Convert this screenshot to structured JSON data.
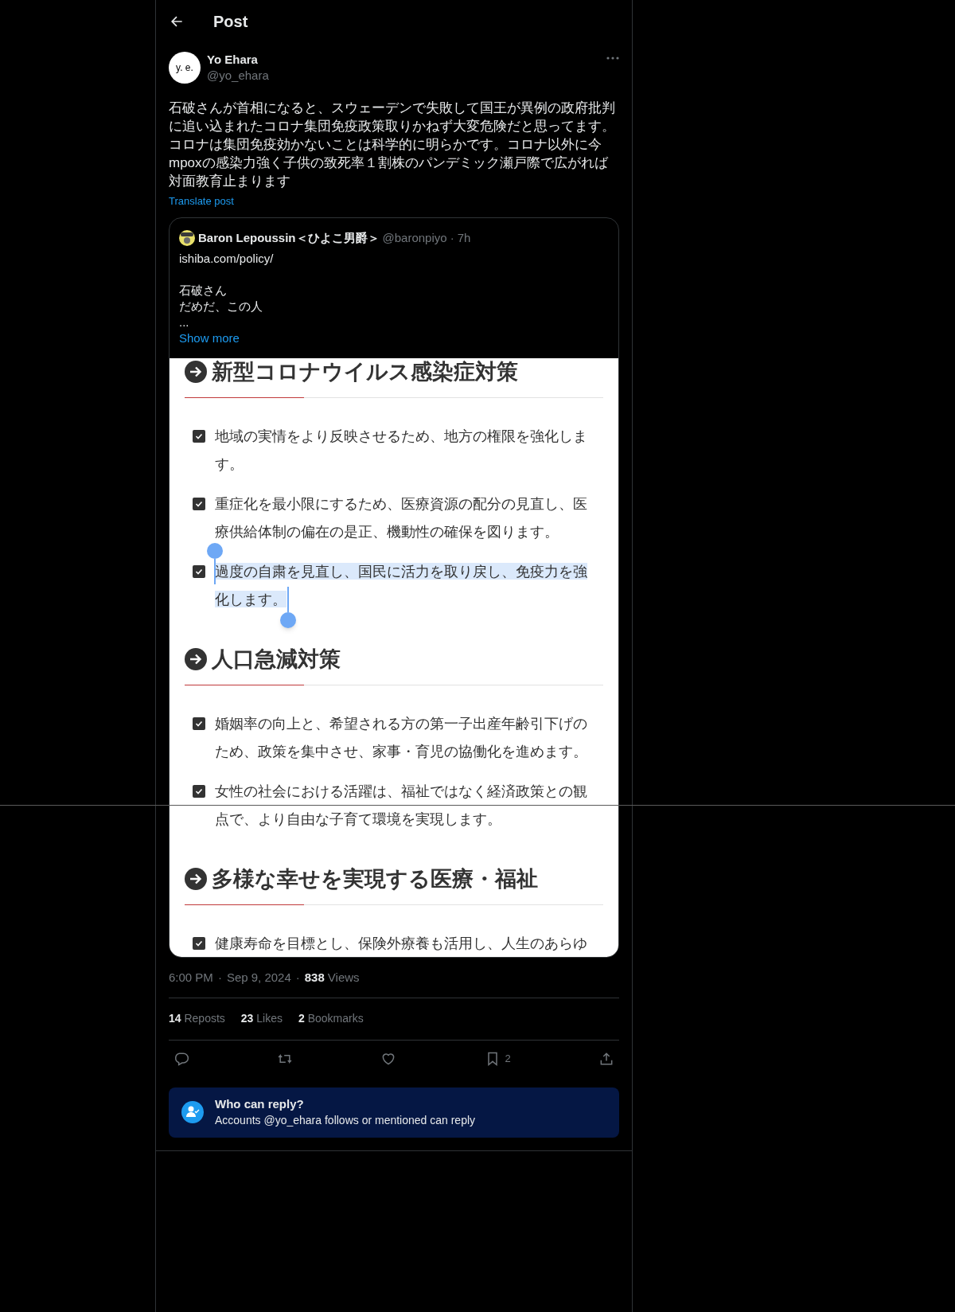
{
  "header": {
    "title": "Post"
  },
  "post": {
    "author": {
      "avatar_text": "y. e.",
      "name": "Yo Ehara",
      "handle": "@yo_ehara"
    },
    "text": "石破さんが首相になると、スウェーデンで失敗して国王が異例の政府批判に追い込まれたコロナ集団免疫政策取りかねず大変危険だと思ってます。コロナは集団免疫効かないことは科学的に明らかです。コロナ以外に今mpoxの感染力強く子供の致死率１割株のパンデミック瀬戸際で広がれば対面教育止まります",
    "translate": "Translate post"
  },
  "quote": {
    "name": "Baron Lepoussin＜ひよこ男爵＞",
    "handle": "@baronpiyo",
    "separator": "·",
    "time": "7h",
    "paragraphs": [
      [
        "ishiba.com/policy/"
      ],
      [
        "石破さん",
        "だめだ、この人",
        "..."
      ]
    ],
    "show_more": "Show more",
    "screenshot": {
      "sections": [
        {
          "heading": "新型コロナウイルス感染症対策",
          "items": [
            {
              "text": "地域の実情をより反映させるため、地方の権限を強化します。",
              "checked": true,
              "selected": false
            },
            {
              "text": "重症化を最小限にするため、医療資源の配分の見直し、医療供給体制の偏在の是正、機動性の確保を図ります。",
              "checked": true,
              "selected": false
            },
            {
              "text": "過度の自粛を見直し、国民に活力を取り戻し、免疫力を強化します。",
              "checked": true,
              "selected": true
            }
          ]
        },
        {
          "heading": "人口急減対策",
          "items": [
            {
              "text": "婚姻率の向上と、希望される方の第一子出産年齢引下げのため、政策を集中させ、家事・育児の協働化を進めます。",
              "checked": true,
              "selected": false
            },
            {
              "text": "女性の社会における活躍は、福祉ではなく経済政策との観点で、より自由な子育て環境を実現します。",
              "checked": true,
              "selected": false
            }
          ]
        },
        {
          "heading": "多様な幸せを実現する医療・福祉",
          "items": [
            {
              "text": "健康寿命を目標とし、保険外療養も活用し、人生のあらゆ",
              "checked": true,
              "selected": false
            }
          ]
        }
      ]
    }
  },
  "meta": {
    "time": "6:00 PM",
    "separator_1": "·",
    "date": "Sep 9, 2024",
    "separator_2": "·",
    "views_count": "838",
    "views_label": "Views"
  },
  "stats": [
    {
      "count": "14",
      "label": "Reposts"
    },
    {
      "count": "23",
      "label": "Likes"
    },
    {
      "count": "2",
      "label": "Bookmarks"
    }
  ],
  "actions": [
    {
      "kind": "reply"
    },
    {
      "kind": "repost"
    },
    {
      "kind": "like"
    },
    {
      "kind": "bookmark",
      "count": "2"
    },
    {
      "kind": "share"
    }
  ],
  "reply_notice": {
    "title": "Who can reply?",
    "text": "Accounts @yo_ehara follows or mentioned can reply"
  }
}
